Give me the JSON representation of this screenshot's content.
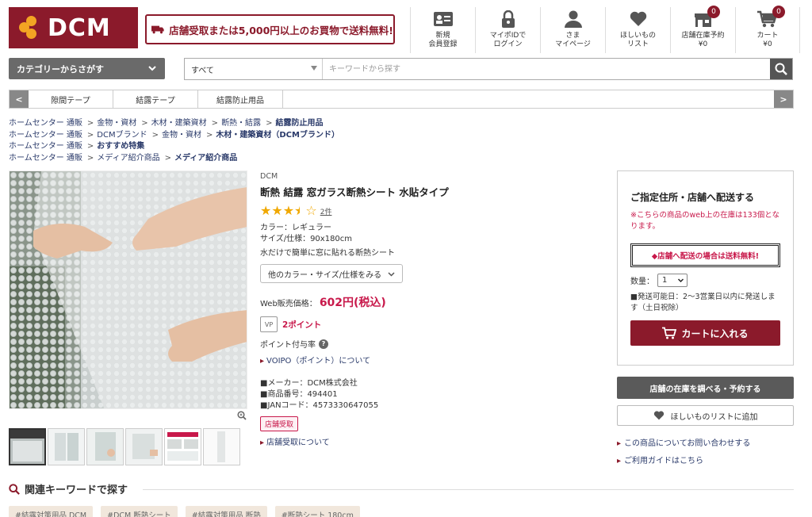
{
  "header": {
    "logo_text": "DCM",
    "promo": "店舗受取または5,000円以上のお買物で送料無料!",
    "nav": [
      {
        "line1": "新規",
        "line2": "会員登録",
        "icon": "member-card-icon"
      },
      {
        "line1": "マイポIDで",
        "line2": "ログイン",
        "icon": "lock-icon"
      },
      {
        "line1": "さま",
        "line2": "マイページ",
        "icon": "user-icon"
      },
      {
        "line1": "ほしいもの",
        "line2": "リスト",
        "icon": "heart-icon"
      },
      {
        "line1": "店舗在庫予約",
        "line2": "¥0",
        "icon": "store-icon",
        "badge": "0"
      },
      {
        "line1": "カート",
        "line2": "¥0",
        "icon": "cart-icon",
        "badge": "0"
      }
    ]
  },
  "search": {
    "category_button": "カテゴリーからさがす",
    "scope": "すべて",
    "placeholder": "キーワードから探す"
  },
  "quick_tags": [
    "隙間テープ",
    "結露テープ",
    "結露防止用品"
  ],
  "breadcrumbs": [
    [
      "ホームセンター 通販",
      "金物・資材",
      "木材・建築資材",
      "断熱・結露",
      "結露防止用品"
    ],
    [
      "ホームセンター 通販",
      "DCMブランド",
      "金物・資材",
      "木材・建築資材（DCMブランド）"
    ],
    [
      "ホームセンター 通販",
      "おすすめ特集"
    ],
    [
      "ホームセンター 通販",
      "メディア紹介商品",
      "メディア紹介商品"
    ]
  ],
  "product": {
    "brand": "DCM",
    "title": "断熱 結露 窓ガラス断熱シート 水貼タイプ",
    "rating": 3.5,
    "review_count": "2件",
    "color": "カラー：レギュラー",
    "size": "サイズ/仕様：90x180cm",
    "description": "水だけで簡単に窓に貼れる断熱シート",
    "variant_button": "他のカラー・サイズ/仕様をみる",
    "price_label": "Web販売価格：",
    "price": "602円(税込)",
    "vp_label": "VP",
    "points": "2ポイント",
    "point_rate": "ポイント付与率",
    "voipo_link": "VOIPO（ポイント）について",
    "maker": "■メーカー：DCM株式会社",
    "item_no": "■商品番号：494401",
    "jan": "■JANコード：4573330647055",
    "pickup_badge": "店舗受取",
    "pickup_link": "店舗受取について"
  },
  "purchase": {
    "title": "ご指定住所・店舗へ配送する",
    "stock_note": "※こちらの商品のweb上の在庫は133個となります。",
    "free_shipping": "◆店舗へ配送の場合は送料無料!",
    "qty_label": "数量：",
    "qty_value": "1",
    "ship_note": "■発送可能日：2〜3営業日以内に発送します（土日祝除）",
    "cart_button": "カートに入れる",
    "stock_button": "店舗の在庫を調べる・予約する",
    "wish_button": "ほしいものリストに追加",
    "links": [
      "この商品についてお問い合わせする",
      "ご利用ガイドはこちら"
    ]
  },
  "related": {
    "title": "関連キーワードで探す",
    "tags": [
      "#結露対策用品 DCM",
      "#DCM 断熱シート",
      "#結露対策用品 断熱",
      "#断熱シート 180cm"
    ]
  },
  "colors": {
    "brand": "#8b1a2b",
    "accent_orange": "#f3a423",
    "price_pink": "#c8194b"
  }
}
